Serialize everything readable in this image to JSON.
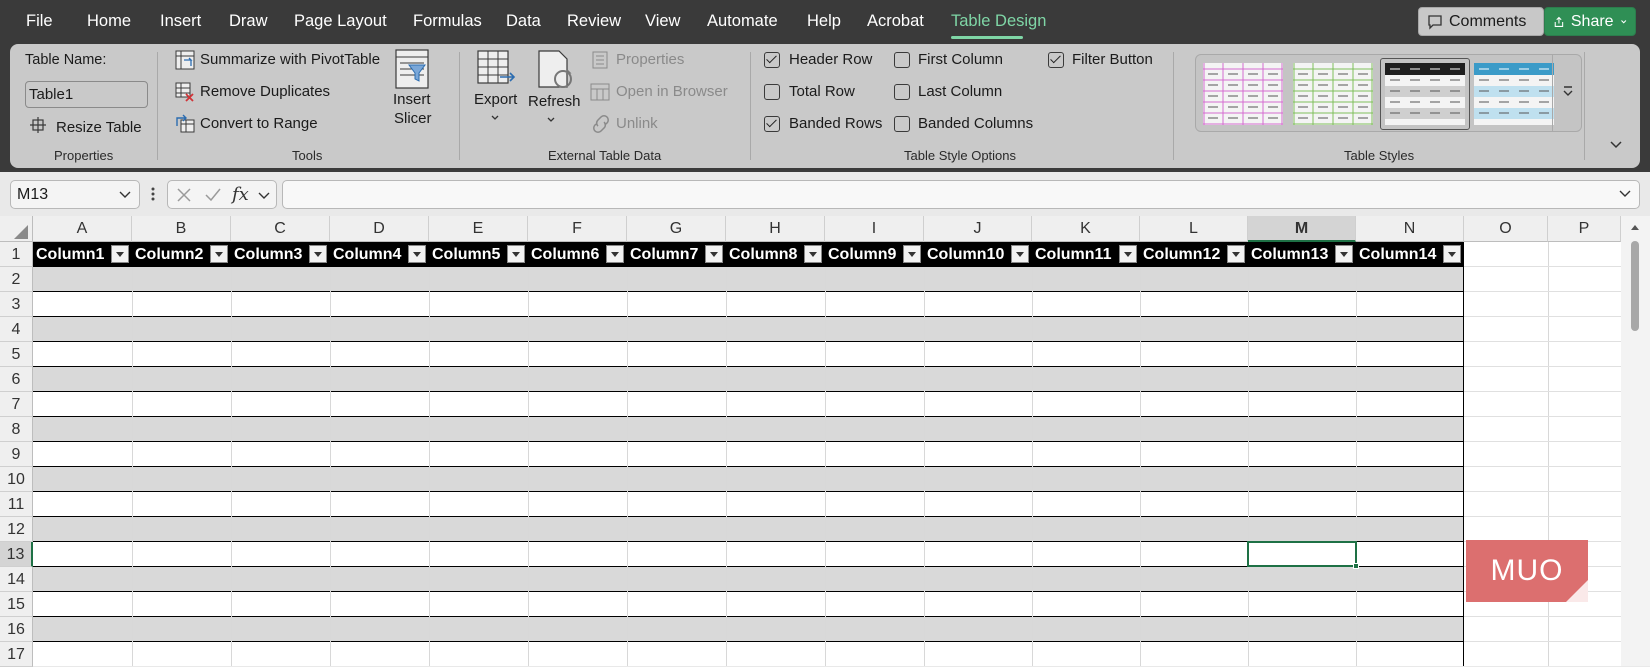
{
  "menu": {
    "items": [
      "File",
      "Home",
      "Insert",
      "Draw",
      "Page Layout",
      "Formulas",
      "Data",
      "Review",
      "View",
      "Automate",
      "Help",
      "Acrobat",
      "Table Design"
    ],
    "active": "Table Design",
    "comments": "Comments",
    "share": "Share"
  },
  "ribbon": {
    "properties": {
      "table_name_label": "Table Name:",
      "table_name_value": "Table1",
      "resize": "Resize Table",
      "title": "Properties"
    },
    "tools": {
      "summarize": "Summarize with PivotTable",
      "remove_duplicates": "Remove Duplicates",
      "convert": "Convert to Range",
      "insert_slicer_1": "Insert",
      "insert_slicer_2": "Slicer",
      "title": "Tools"
    },
    "external": {
      "export": "Export",
      "refresh": "Refresh",
      "properties": "Properties",
      "open_browser": "Open in Browser",
      "unlink": "Unlink",
      "title": "External Table Data"
    },
    "style_options": {
      "header_row": "Header Row",
      "total_row": "Total Row",
      "banded_rows": "Banded Rows",
      "first_column": "First Column",
      "last_column": "Last Column",
      "banded_columns": "Banded Columns",
      "filter_button": "Filter Button",
      "title": "Table Style Options",
      "checked": {
        "header_row": true,
        "total_row": false,
        "banded_rows": true,
        "first_column": false,
        "last_column": false,
        "banded_columns": false,
        "filter_button": true
      }
    },
    "styles": {
      "title": "Table Styles",
      "swatches": [
        "#d56bd0",
        "#7fbf5b",
        "#1f1f1f",
        "#3b9bc8"
      ]
    }
  },
  "formula_bar": {
    "name_box": "M13",
    "fx": "fx",
    "formula": ""
  },
  "sheet": {
    "columns": [
      "A",
      "B",
      "C",
      "D",
      "E",
      "F",
      "G",
      "H",
      "I",
      "J",
      "K",
      "L",
      "M",
      "N",
      "O",
      "P"
    ],
    "selected_column": "M",
    "rows": [
      "1",
      "2",
      "3",
      "4",
      "5",
      "6",
      "7",
      "8",
      "9",
      "10",
      "11",
      "12",
      "13",
      "14",
      "15",
      "16",
      "17"
    ],
    "selected_row": "13",
    "table_headers": [
      "Column1",
      "Column2",
      "Column3",
      "Column4",
      "Column5",
      "Column6",
      "Column7",
      "Column8",
      "Column9",
      "Column10",
      "Column11",
      "Column12",
      "Column13",
      "Column14"
    ],
    "selected_cell": "M13"
  },
  "watermark": "MUO"
}
